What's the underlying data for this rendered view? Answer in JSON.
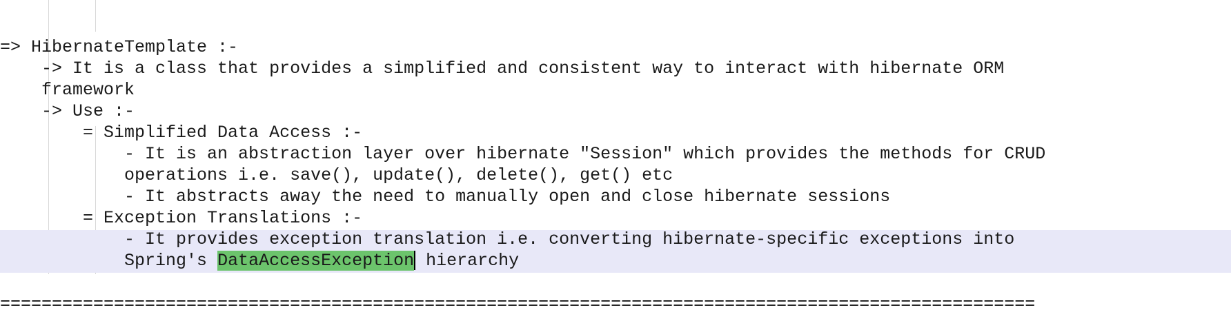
{
  "editor": {
    "lines": [
      "=> HibernateTemplate :-",
      "    -> It is a class that provides a simplified and consistent way to interact with hibernate ORM",
      "    framework",
      "    -> Use :-",
      "        = Simplified Data Access :-",
      "            - It is an abstraction layer over hibernate \"Session\" which provides the methods for CRUD",
      "            operations i.e. save(), update(), delete(), get() etc",
      "            - It abstracts away the need to manually open and close hibernate sessions",
      "        = Exception Translations :-",
      "            - It provides exception translation i.e. converting hibernate-specific exceptions into"
    ],
    "last_line": {
      "prefix": "            Spring's ",
      "selected": "DataAccessException",
      "suffix": " hierarchy"
    },
    "separator": "===================================================================================================="
  },
  "colors": {
    "background": "#ffffff",
    "current_line_highlight": "#e8e8f8",
    "selection": "#6cc46c",
    "indent_guide": "#d8d8d8"
  }
}
